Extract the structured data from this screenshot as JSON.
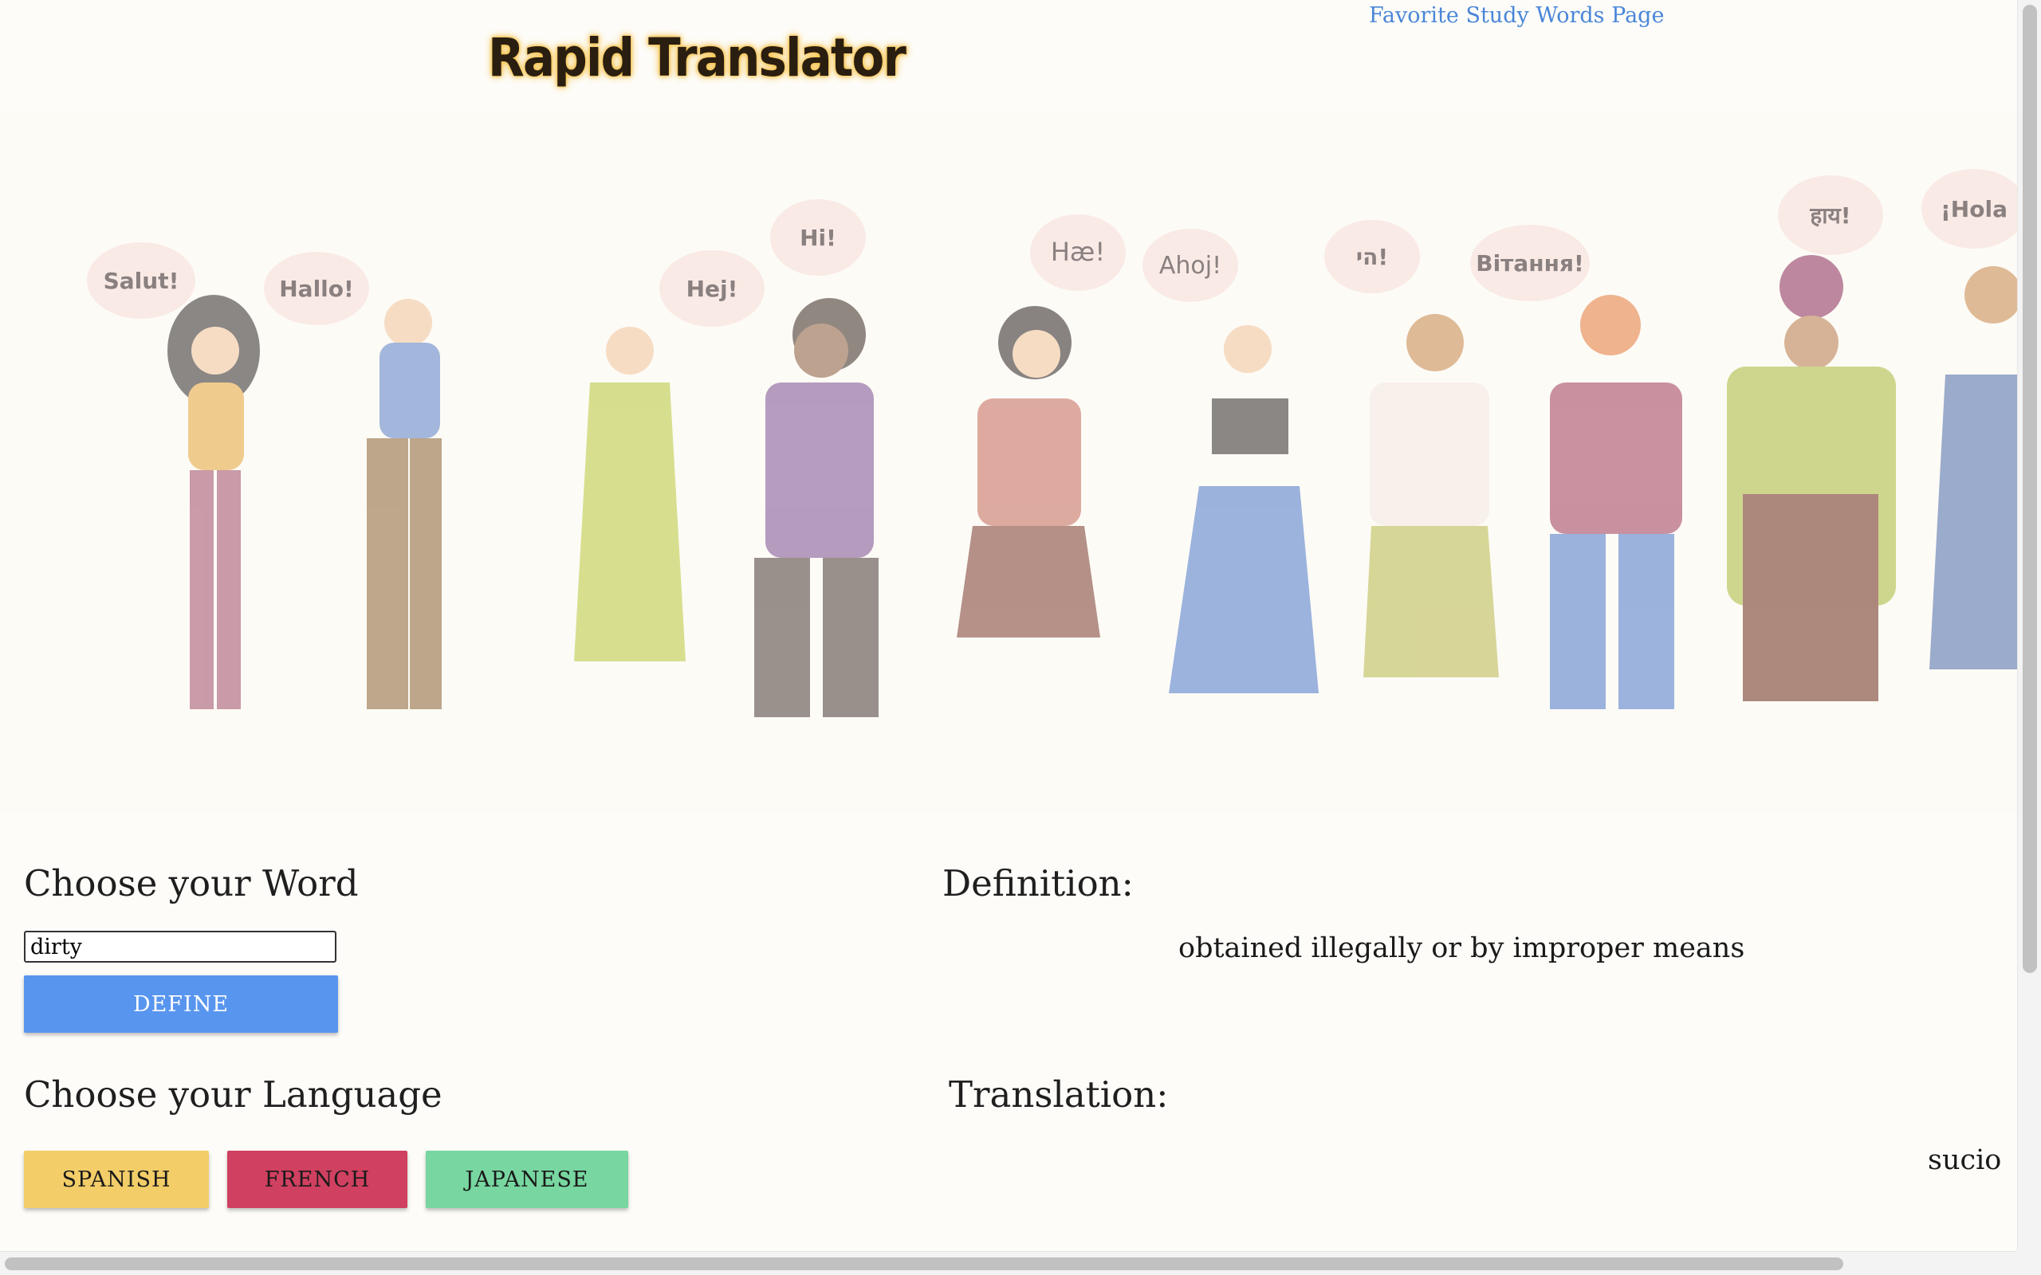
{
  "header": {
    "title": "Rapid Translator",
    "favorites_link": "Favorite Study Words Page"
  },
  "banner": {
    "greetings": [
      "Salut!",
      "Hallo!",
      "Hej!",
      "Hi!",
      "Hæ!",
      "Ahoj!",
      "הי!",
      "Вітання!",
      "हाय!",
      "¡Hola"
    ]
  },
  "word_section": {
    "heading": "Choose your Word",
    "input_value": "dirty",
    "define_label": "DEFINE"
  },
  "language_section": {
    "heading": "Choose your Language",
    "languages": [
      "SPANISH",
      "FRENCH",
      "JAPANESE"
    ]
  },
  "definition_section": {
    "heading": "Definition:",
    "text": "obtained illegally or by improper means"
  },
  "translation_section": {
    "heading": "Translation:",
    "text": "sucio"
  },
  "colors": {
    "define_button": "#5895ee",
    "spanish_button": "#f2cd68",
    "french_button": "#d04060",
    "japanese_button": "#78d6a0",
    "link": "#4a86d8",
    "title_glow": "#f5c24a"
  }
}
